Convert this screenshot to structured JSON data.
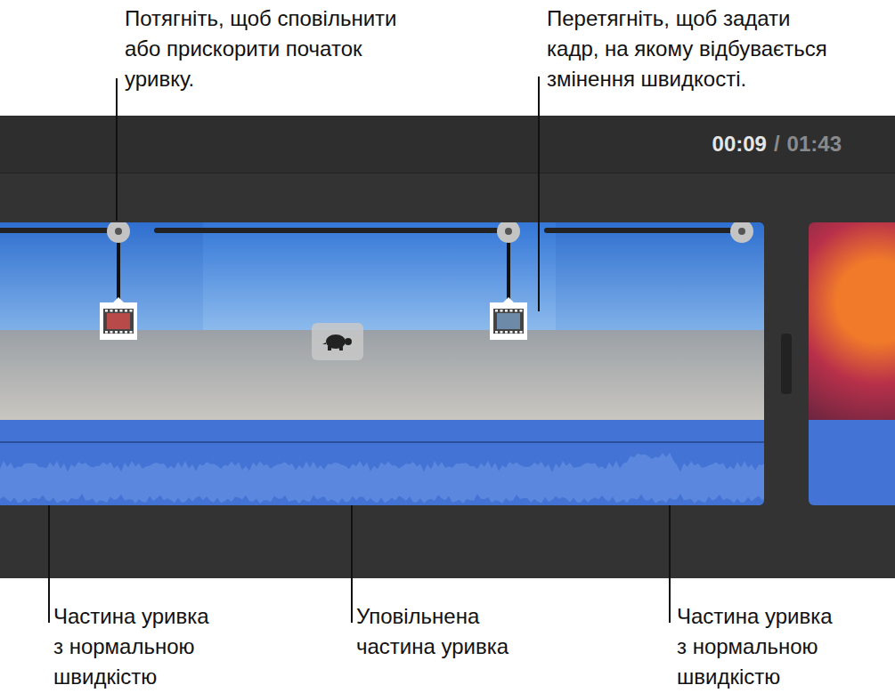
{
  "top_callouts": [
    {
      "lines": [
        "Потягніть, щоб сповільнити",
        "або прискорити початок",
        "уривку."
      ]
    },
    {
      "lines": [
        "Перетягніть, щоб задати",
        "кадр, на якому відбувається",
        "змінення швидкості."
      ]
    }
  ],
  "time": {
    "current": "00:09",
    "separator": "/",
    "total": "01:43"
  },
  "segments": [
    {
      "kind": "normal",
      "label": [
        "Частина уривка",
        "з нормальною",
        "швидкістю"
      ]
    },
    {
      "kind": "slow",
      "label": [
        "Уповільнена",
        "частина уривка"
      ]
    },
    {
      "kind": "normal",
      "label": [
        "Частина уривка",
        "з нормальною",
        "швидкістю"
      ]
    }
  ]
}
